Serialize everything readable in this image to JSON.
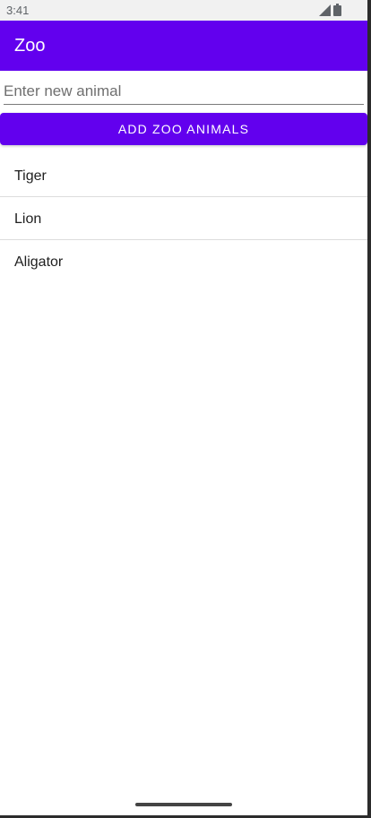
{
  "status_bar": {
    "time": "3:41",
    "icons": [
      "signal-icon",
      "battery-icon"
    ]
  },
  "app_bar": {
    "title": "Zoo",
    "color": "#6200ee"
  },
  "form": {
    "input_value": "",
    "input_placeholder": "Enter new animal",
    "add_button_label": "ADD ZOO ANIMALS"
  },
  "animals": [
    {
      "name": "Tiger"
    },
    {
      "name": "Lion"
    },
    {
      "name": "Aligator"
    }
  ]
}
